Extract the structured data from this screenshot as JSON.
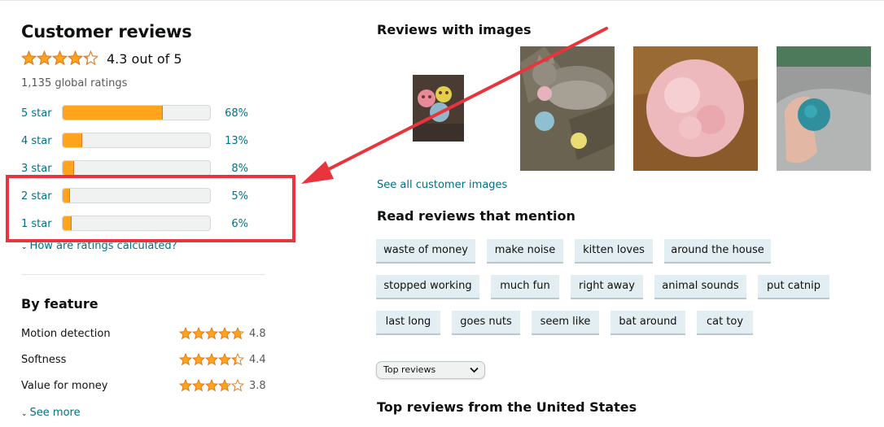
{
  "reviews": {
    "title": "Customer reviews",
    "average_rating": 4.3,
    "average_text": "4.3 out of 5",
    "global_ratings": "1,135 global ratings",
    "histogram": [
      {
        "label": "5 star",
        "percent_text": "68%",
        "fraction": 0.68
      },
      {
        "label": "4 star",
        "percent_text": "13%",
        "fraction": 0.13
      },
      {
        "label": "3 star",
        "percent_text": "8%",
        "fraction": 0.08
      },
      {
        "label": "2 star",
        "percent_text": "5%",
        "fraction": 0.05
      },
      {
        "label": "1 star",
        "percent_text": "6%",
        "fraction": 0.06
      }
    ],
    "how_calculated": "How are ratings calculated?"
  },
  "by_feature": {
    "title": "By feature",
    "items": [
      {
        "name": "Motion detection",
        "rating": 4.8,
        "value_text": "4.8"
      },
      {
        "name": "Softness",
        "rating": 4.4,
        "value_text": "4.4"
      },
      {
        "name": "Value for money",
        "rating": 3.8,
        "value_text": "3.8"
      }
    ],
    "see_more": "See more"
  },
  "images_section": {
    "title": "Reviews with images",
    "thumbnails": [
      "three-felt-balls",
      "cat-with-balls",
      "pink-felt-ball",
      "hand-holding-blue-ball"
    ],
    "see_all": "See all customer images"
  },
  "mentions": {
    "title": "Read reviews that mention",
    "chips": [
      "waste of money",
      "make noise",
      "kitten loves",
      "around the house",
      "stopped working",
      "much fun",
      "right away",
      "animal sounds",
      "put catnip",
      "last long",
      "goes nuts",
      "seem like",
      "bat around",
      "cat toy"
    ]
  },
  "sort": {
    "selected": "Top reviews",
    "icon": "chevron-down-icon"
  },
  "top_reviews": {
    "title": "Top reviews from the United States"
  },
  "colors": {
    "star": "#ffa41c",
    "star_outline": "#de7921",
    "link": "#007185",
    "chip_bg": "#e3eef2",
    "annotation": "#e8343c"
  }
}
